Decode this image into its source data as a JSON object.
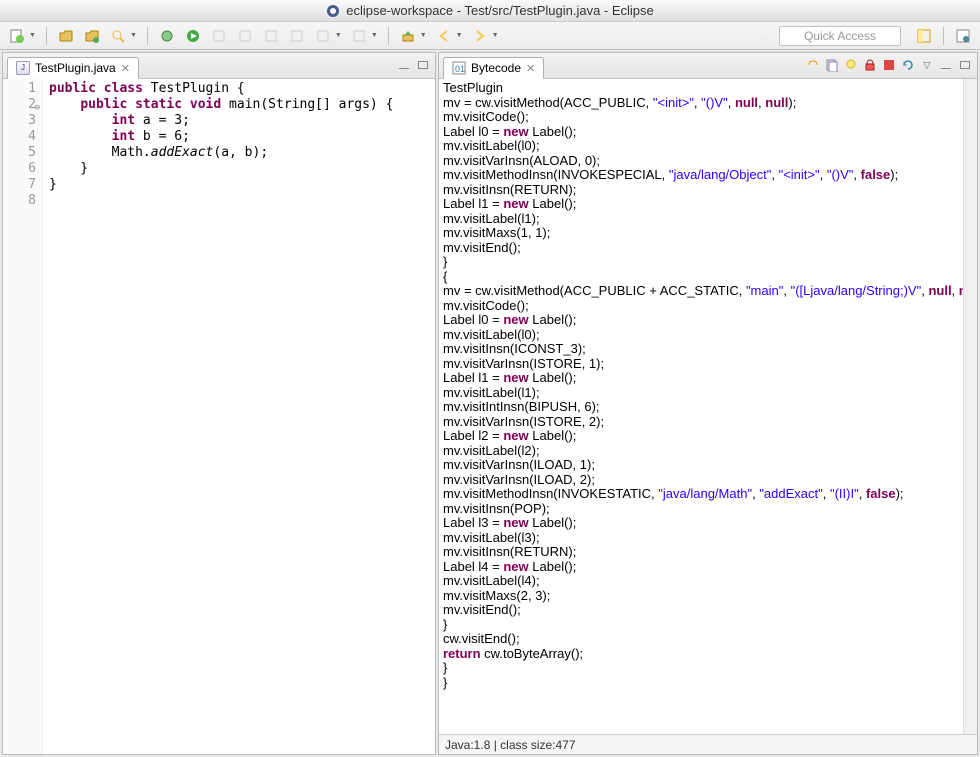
{
  "window_title": "eclipse-workspace - Test/src/TestPlugin.java - Eclipse",
  "quick_access_placeholder": "Quick Access",
  "left_tab": {
    "label": "TestPlugin.java"
  },
  "right_tab": {
    "label": "Bytecode"
  },
  "source_lines": [
    {
      "n": 1,
      "tokens": [
        [
          "kw",
          "public"
        ],
        [
          " "
        ],
        [
          "kw",
          "class"
        ],
        [
          " "
        ],
        [
          "cls",
          "TestPlugin"
        ],
        [
          " {"
        ]
      ]
    },
    {
      "n": 2,
      "expand": true,
      "tokens": [
        [
          "    "
        ],
        [
          "kw",
          "public"
        ],
        [
          " "
        ],
        [
          "kw",
          "static"
        ],
        [
          " "
        ],
        [
          "kw",
          "void"
        ],
        [
          " "
        ],
        [
          "cls",
          "main"
        ],
        [
          "(String[] args) {"
        ]
      ]
    },
    {
      "n": 3,
      "tokens": [
        [
          "        "
        ],
        [
          "kw",
          "int"
        ],
        [
          " a = 3;"
        ]
      ]
    },
    {
      "n": 4,
      "tokens": [
        [
          "        "
        ],
        [
          "kw",
          "int"
        ],
        [
          " b = 6;"
        ]
      ]
    },
    {
      "n": 5,
      "tokens": [
        [
          "        Math."
        ],
        [
          "m-it",
          "addExact"
        ],
        [
          "(a, b);"
        ]
      ]
    },
    {
      "n": 6,
      "tokens": [
        [
          "    }"
        ]
      ]
    },
    {
      "n": 7,
      "tokens": [
        [
          "}"
        ]
      ]
    },
    {
      "n": 8,
      "tokens": [
        [
          ""
        ]
      ]
    }
  ],
  "bytecode_header": "TestPlugin",
  "bytecode_lines": [
    [
      [
        "bc-n",
        "mv = cw.visitMethod(ACC_PUBLIC, "
      ],
      [
        "bc-s",
        "\"<init>\""
      ],
      [
        "bc-n",
        ", "
      ],
      [
        "bc-s",
        "\"()V\""
      ],
      [
        "bc-n",
        ", "
      ],
      [
        "bc-k",
        "null"
      ],
      [
        "bc-n",
        ", "
      ],
      [
        "bc-k",
        "null"
      ],
      [
        "bc-n",
        ");"
      ]
    ],
    [
      [
        "bc-n",
        "mv.visitCode();"
      ]
    ],
    [
      [
        "bc-n",
        "Label l0 = "
      ],
      [
        "bc-k",
        "new"
      ],
      [
        "bc-n",
        " Label();"
      ]
    ],
    [
      [
        "bc-n",
        "mv.visitLabel(l0);"
      ]
    ],
    [
      [
        "bc-n",
        "mv.visitVarInsn(ALOAD, 0);"
      ]
    ],
    [
      [
        "bc-n",
        "mv.visitMethodInsn(INVOKESPECIAL, "
      ],
      [
        "bc-s",
        "\"java/lang/Object\""
      ],
      [
        "bc-n",
        ", "
      ],
      [
        "bc-s",
        "\"<init>\""
      ],
      [
        "bc-n",
        ", "
      ],
      [
        "bc-s",
        "\"()V\""
      ],
      [
        "bc-n",
        ", "
      ],
      [
        "bc-k",
        "false"
      ],
      [
        "bc-n",
        ");"
      ]
    ],
    [
      [
        "bc-n",
        "mv.visitInsn(RETURN);"
      ]
    ],
    [
      [
        "bc-n",
        "Label l1 = "
      ],
      [
        "bc-k",
        "new"
      ],
      [
        "bc-n",
        " Label();"
      ]
    ],
    [
      [
        "bc-n",
        "mv.visitLabel(l1);"
      ]
    ],
    [
      [
        "bc-n",
        "mv.visitMaxs(1, 1);"
      ]
    ],
    [
      [
        "bc-n",
        "mv.visitEnd();"
      ]
    ],
    [
      [
        "bc-n",
        "}"
      ]
    ],
    [
      [
        "bc-n",
        "{"
      ]
    ],
    [
      [
        "bc-n",
        "mv = cw.visitMethod(ACC_PUBLIC + ACC_STATIC, "
      ],
      [
        "bc-s",
        "\"main\""
      ],
      [
        "bc-n",
        ", "
      ],
      [
        "bc-s",
        "\"([Ljava/lang/String;)V\""
      ],
      [
        "bc-n",
        ", "
      ],
      [
        "bc-k",
        "null"
      ],
      [
        "bc-n",
        ", "
      ],
      [
        "bc-k",
        "null"
      ],
      [
        "bc-n",
        ");"
      ]
    ],
    [
      [
        "bc-n",
        "mv.visitCode();"
      ]
    ],
    [
      [
        "bc-n",
        "Label l0 = "
      ],
      [
        "bc-k",
        "new"
      ],
      [
        "bc-n",
        " Label();"
      ]
    ],
    [
      [
        "bc-n",
        "mv.visitLabel(l0);"
      ]
    ],
    [
      [
        "bc-n",
        "mv.visitInsn(ICONST_3);"
      ]
    ],
    [
      [
        "bc-n",
        "mv.visitVarInsn(ISTORE, 1);"
      ]
    ],
    [
      [
        "bc-n",
        "Label l1 = "
      ],
      [
        "bc-k",
        "new"
      ],
      [
        "bc-n",
        " Label();"
      ]
    ],
    [
      [
        "bc-n",
        "mv.visitLabel(l1);"
      ]
    ],
    [
      [
        "bc-n",
        "mv.visitIntInsn(BIPUSH, 6);"
      ]
    ],
    [
      [
        "bc-n",
        "mv.visitVarInsn(ISTORE, 2);"
      ]
    ],
    [
      [
        "bc-n",
        "Label l2 = "
      ],
      [
        "bc-k",
        "new"
      ],
      [
        "bc-n",
        " Label();"
      ]
    ],
    [
      [
        "bc-n",
        "mv.visitLabel(l2);"
      ]
    ],
    [
      [
        "bc-n",
        "mv.visitVarInsn(ILOAD, 1);"
      ]
    ],
    [
      [
        "bc-n",
        "mv.visitVarInsn(ILOAD, 2);"
      ]
    ],
    [
      [
        "bc-n",
        "mv.visitMethodInsn(INVOKESTATIC, "
      ],
      [
        "bc-s",
        "\"java/lang/Math\""
      ],
      [
        "bc-n",
        ", "
      ],
      [
        "bc-s",
        "\"addExact\""
      ],
      [
        "bc-n",
        ", "
      ],
      [
        "bc-s",
        "\"(II)I\""
      ],
      [
        "bc-n",
        ", "
      ],
      [
        "bc-k",
        "false"
      ],
      [
        "bc-n",
        ");"
      ]
    ],
    [
      [
        "bc-n",
        "mv.visitInsn(POP);"
      ]
    ],
    [
      [
        "bc-n",
        "Label l3 = "
      ],
      [
        "bc-k",
        "new"
      ],
      [
        "bc-n",
        " Label();"
      ]
    ],
    [
      [
        "bc-n",
        "mv.visitLabel(l3);"
      ]
    ],
    [
      [
        "bc-n",
        "mv.visitInsn(RETURN);"
      ]
    ],
    [
      [
        "bc-n",
        "Label l4 = "
      ],
      [
        "bc-k",
        "new"
      ],
      [
        "bc-n",
        " Label();"
      ]
    ],
    [
      [
        "bc-n",
        "mv.visitLabel(l4);"
      ]
    ],
    [
      [
        "bc-n",
        "mv.visitMaxs(2, 3);"
      ]
    ],
    [
      [
        "bc-n",
        "mv.visitEnd();"
      ]
    ],
    [
      [
        "bc-n",
        "}"
      ]
    ],
    [
      [
        "bc-n",
        "cw.visitEnd();"
      ]
    ],
    [
      [
        "bc-n",
        ""
      ]
    ],
    [
      [
        "bc-k",
        "return"
      ],
      [
        "bc-n",
        " cw.toByteArray();"
      ]
    ],
    [
      [
        "bc-n",
        "}"
      ]
    ],
    [
      [
        "bc-n",
        "}"
      ]
    ]
  ],
  "status_text": "Java:1.8 | class size:477"
}
